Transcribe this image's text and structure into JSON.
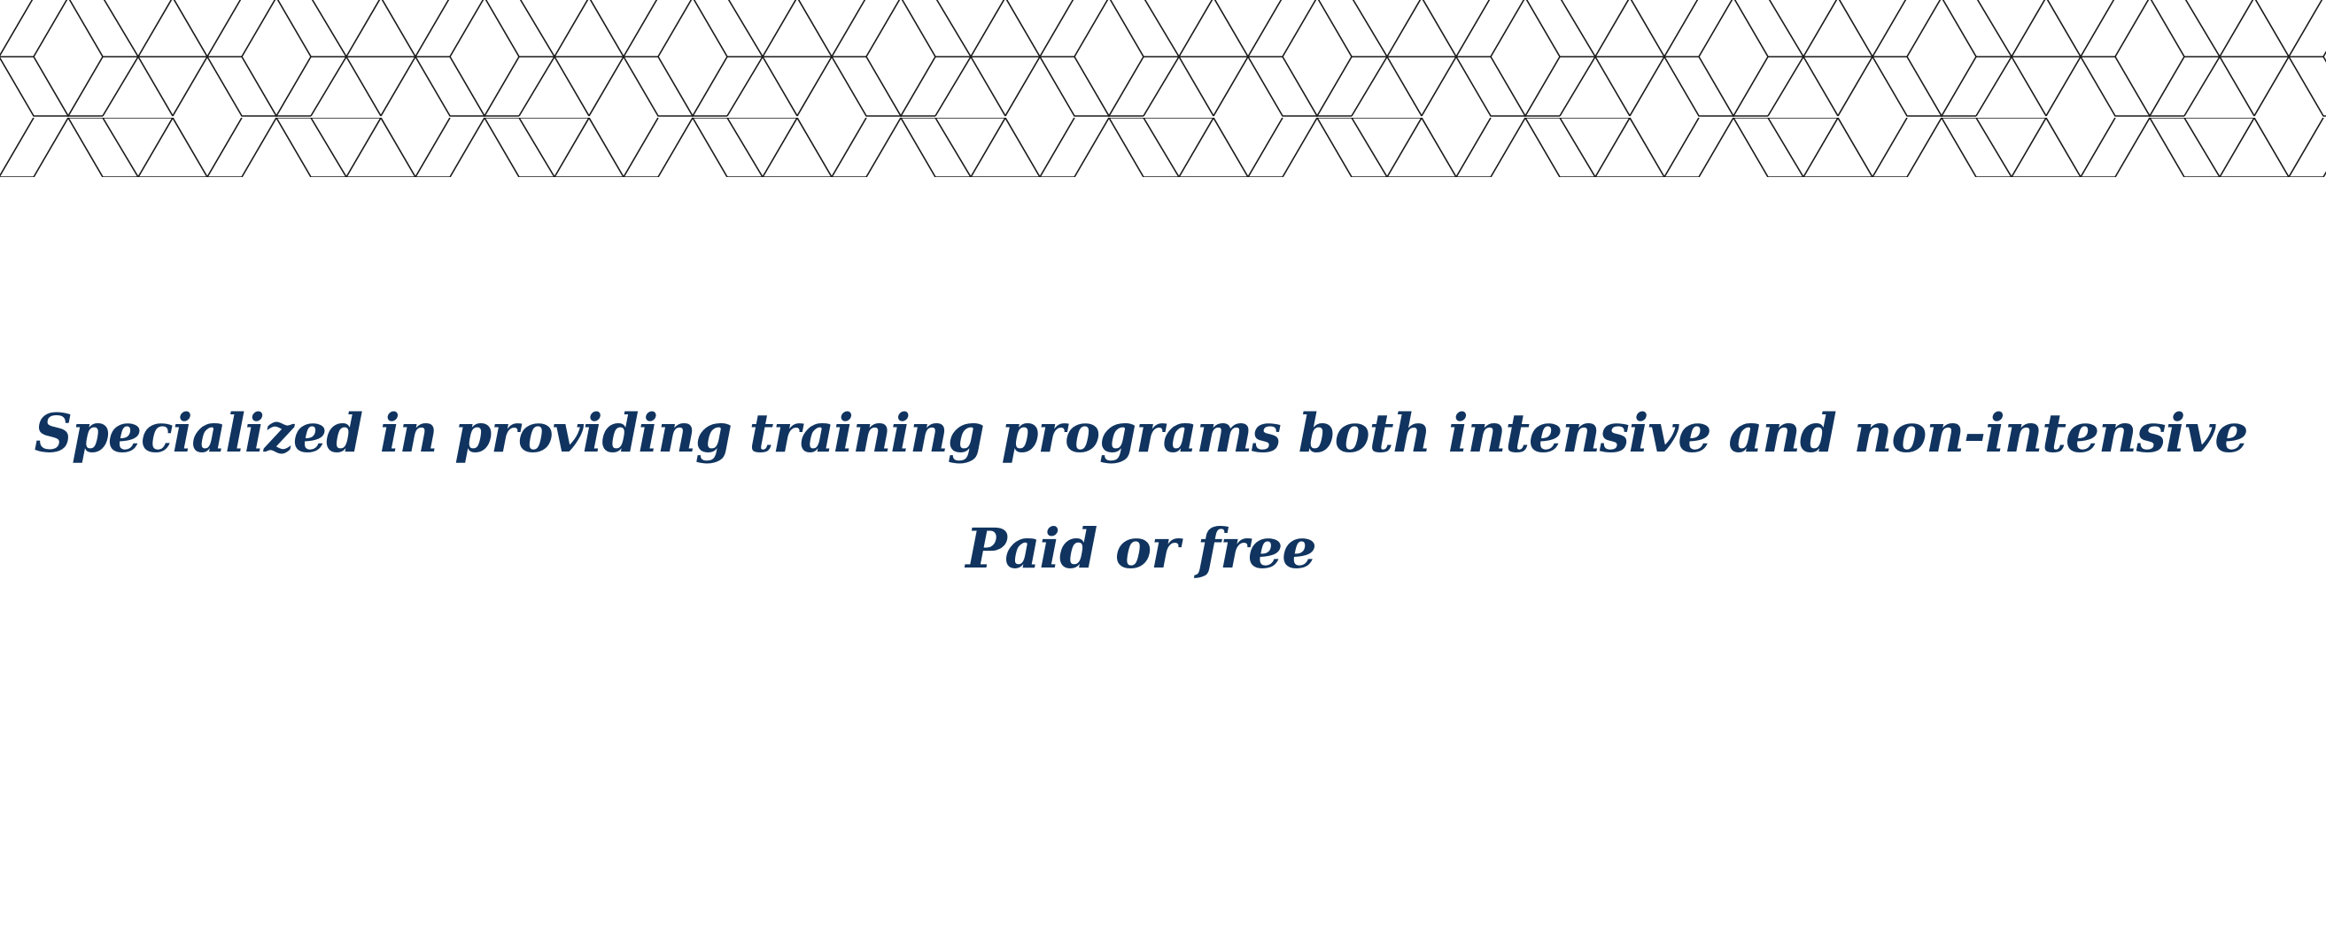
{
  "hero": {
    "pattern_icon": "isometric-cube-pattern",
    "line_color": "#1a1a1a",
    "headline": "Specialized in providing training programs both intensive and non-intensive",
    "subheadline": "Paid or free",
    "text_color": "#10345f"
  }
}
